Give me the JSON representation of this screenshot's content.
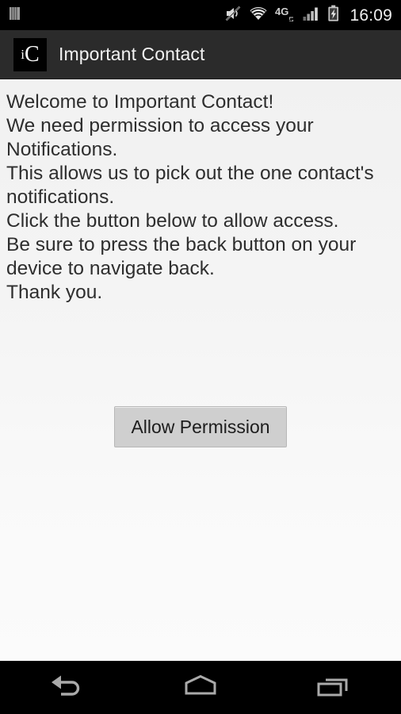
{
  "status_bar": {
    "notification_icon": "notification-bars-icon",
    "icons": [
      "volume-off-icon",
      "wifi-icon",
      "lte-4g-icon",
      "signal-bars-icon",
      "battery-charging-icon"
    ],
    "clock": "16:09"
  },
  "app_bar": {
    "logo_i": "i",
    "logo_c": "C",
    "title": "Important Contact"
  },
  "content": {
    "lines": [
      "Welcome to Important Contact!",
      "We need permission to access your",
      "Notifications.",
      "This allows us to pick out the one contact's",
      "notifications.",
      "Click the button below to allow access.",
      "Be sure to press the back button on your",
      "device to navigate back.",
      "Thank you."
    ],
    "button_label": "Allow Permission"
  },
  "nav_bar": {
    "back_label": "back-icon",
    "home_label": "home-icon",
    "recents_label": "recents-icon"
  },
  "colors": {
    "status_bar_bg": "#000000",
    "app_bar_bg": "#2b2b2b",
    "content_bg": "#f4f4f4",
    "button_bg": "#cfcfcf",
    "text": "#2e2e2e",
    "nav_icon": "#a8a8a8"
  }
}
